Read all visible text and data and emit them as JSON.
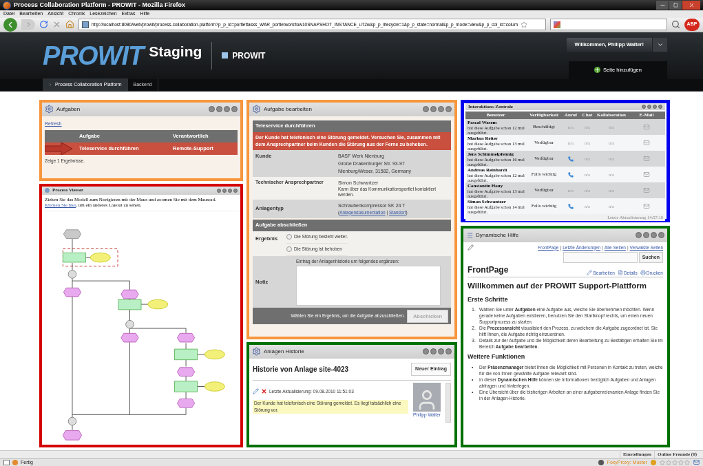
{
  "window": {
    "title": "Process Collaboration Platform - PROWIT - Mozilla Firefox"
  },
  "menu": [
    "Datei",
    "Bearbeiten",
    "Ansicht",
    "Chronik",
    "Lesezeichen",
    "Extras",
    "Hilfe"
  ],
  "address_bar": {
    "url": "http://localhost:8080/web/prowit/process-collaboration-platform?p_p_id=portlettasks_WAR_portletworkflow10SNAPSHOT_INSTANCE_uT2w&p_p_lifecycle=1&p_p_state=normal&p_p_mode=view&p_p_col_id=colum",
    "addon_badge": "ABP"
  },
  "header": {
    "logo": "PROWIT",
    "logo_suffix": "Staging",
    "site": "PROWIT",
    "user_button": "Willkommen, Philipp Walter!",
    "add_page": "Seite hinzufügen"
  },
  "nav": [
    {
      "label": "Process Collaboration Platform",
      "selected": true
    },
    {
      "label": "Backend",
      "selected": false
    }
  ],
  "tasks": {
    "title": "Aufgaben",
    "refresh": "Refresh",
    "columns": [
      "Aufgabe",
      "Verantwortlich"
    ],
    "rows": [
      {
        "task": "Teleservice durchführen",
        "owner": "Remote-Support",
        "selected": true
      }
    ],
    "summary": "Zeige 1 Ergebnisse."
  },
  "process_viewer": {
    "title": "Process Viewer",
    "hint": "Ziehen Sie das Modell zum Navigieren mit der Maus und zoomen Sie mit dem Mausrad.",
    "link": "Klicken Sie hier",
    "hint_end": ", um ein anderes Layout zu sehen."
  },
  "task_edit": {
    "title": "Aufgabe bearbeiten",
    "task": "Teleservice durchführen",
    "description": "Der Kunde hat telefonisch eine Störung gemeldet. Versuchen Sie, zusammen mit dem Ansprechpartner beim Kunden die Störung aus der Ferne zu beheben.",
    "customer_label": "Kunde",
    "customer": [
      "BASF Werk Nienburg",
      "Große Drakenburger Str. 93-97",
      "Nienburg/Weser, 31582, Germany"
    ],
    "contact_label": "Technischer Ansprechpartner",
    "contact": "Simon Schwantzer",
    "contact_note": "Kann über das Kommunikationsportlet kontaktiert werden.",
    "type_label": "Anlagentyp",
    "type": "Schraubenkompressor SK 24 T",
    "links_prefix": "(",
    "links": [
      "Anlagendokumentation",
      "Standort"
    ],
    "links_separator": " | ",
    "links_suffix": ")",
    "close_heading": "Aufgabe abschließen",
    "result_label": "Ergebnis",
    "results": [
      {
        "label": "Die Störung besteht weiter.",
        "selected": false
      },
      {
        "label": "Die Störung ist behoben",
        "selected": false
      }
    ],
    "note_label": "Notiz",
    "note_hint": "Eintrag der Anlagenhistorie um folgendes ergänzen:",
    "footer_hint": "Wählen Sie ein Ergebnis, um die Aufgabe abzuschließen.",
    "submit": {
      "label": "Abschicken",
      "disabled": true
    }
  },
  "history": {
    "title": "Anlagen Historie",
    "heading": "Historie von Anlage site-4023",
    "new_button": "Neuer Eintrag",
    "updated": "Letzte Aktualisierung: 09.08.2010 11:51:03",
    "entry": "Der Kunde hat telefonisch eine Störung gemeldet. Es liegt tatsächlich eine Störung vor.",
    "author": "Philipp Walter"
  },
  "interaction": {
    "title": "Interaktions-Zentrale",
    "columns": [
      "Benutzer",
      "Verfügbarkeit",
      "Anruf",
      "Chat",
      "Kollaboration",
      "E-Mail"
    ],
    "rows": [
      {
        "name": "Pascal Wasem",
        "note": "hat diese Aufgabe schon 12 mal ausgeführt.",
        "availability": "Beschäftigt",
        "call": {
          "kind": "text",
          "text": "n/a"
        },
        "chat": "n/a",
        "collab": "n/a"
      },
      {
        "name": "Markus Reiter",
        "note": "hat diese Aufgabe schon 13 mal ausgeführt.",
        "availability": "Verfügbar",
        "call": {
          "kind": "text",
          "text": "n/a"
        },
        "chat": "n/a",
        "collab": "n/a"
      },
      {
        "name": "Jens Schimmelpfennig",
        "note": "hat diese Aufgabe schon 16 mal ausgeführt.",
        "availability": "Verfügbar",
        "call": {
          "kind": "phone"
        },
        "chat": "n/a",
        "collab": "n/a"
      },
      {
        "name": "Andreas Reinhardt",
        "note": "hat diese Aufgabe schon 12 mal ausgeführt.",
        "availability": "Falls wichtig",
        "call": {
          "kind": "phone"
        },
        "chat": "n/a",
        "collab": "n/a"
      },
      {
        "name": "Constantin Houy",
        "note": "hat diese Aufgabe schon 13 mal ausgeführt.",
        "availability": "Verfügbar",
        "call": {
          "kind": "text",
          "text": "n/a"
        },
        "chat": "n/a",
        "collab": "n/a"
      },
      {
        "name": "Simon Schwantzer",
        "note": "hat diese Aufgabe schon 14 mal ausgeführt.",
        "availability": "Falls wichtig",
        "call": {
          "kind": "phone"
        },
        "chat": "n/a",
        "collab": "n/a"
      }
    ],
    "footer": "Letzte Aktualisierung 14:57:10"
  },
  "help": {
    "title": "Dynamische Hilfe",
    "links": [
      "FrontPage",
      "Letzte Änderungen",
      "Alle Seiten",
      "Verwaiste Seiten"
    ],
    "separator": "|",
    "search_button": "Suchen",
    "page_title": "FrontPage",
    "actions": [
      "Bearbeiten",
      "Details",
      "Drucken"
    ],
    "heading": "Willkommen auf der PROWIT Support-Plattform",
    "sections": [
      {
        "title": "Erste Schritte",
        "items": [
          {
            "marker": "1.",
            "text": "Wählen Sie unter **Aufgaben** eine Aufgabe aus, welche Sie übernehmen möchten. Wenn gerade keine Aufgaben existieren, benutzen Sie den Startknopf rechts, um einen neuen Supportprozess zu starten."
          },
          {
            "marker": "2.",
            "text": "Die **Prozessansicht** visualisiert den Prozess, zu welchem die Aufgabe zugeordnet ist. Sie hilft Ihnen, die Aufgabe richtig einzuordnen."
          },
          {
            "marker": "3.",
            "text": "Details zur der Aufgabe und die Möglichkeit deren Bearbeitung zu Bestätigen erhalten Sie im Bereich **Aufgabe bearbeiten**."
          }
        ]
      },
      {
        "title": "Weitere Funktionen",
        "items": [
          {
            "marker": "•",
            "text": "Der **Präsenzmanager** bietet Ihnen die Möglichkeit mit Personen in Kontakt zu treten, welche für die von Ihnen gewählte Aufgabe relevant sind."
          },
          {
            "marker": "•",
            "text": "In dieser **Dynamischen Hilfe** können sie Informationen bezüglich Aufgaben und Anlagen abfragen und hinterlegen."
          },
          {
            "marker": "•",
            "text": "Eine Übersicht über die bisherigen Arbeiten an einer aufgabenrelevanten Anlage finden Sie in der Anlagen-Historie."
          }
        ]
      }
    ]
  },
  "bottom_bar": [
    "Einstellungen",
    "Online Freunde (0)"
  ],
  "status_bar": {
    "text": "Fertig",
    "proxy": "FoxyProxy: Muster",
    "stars": 0
  }
}
